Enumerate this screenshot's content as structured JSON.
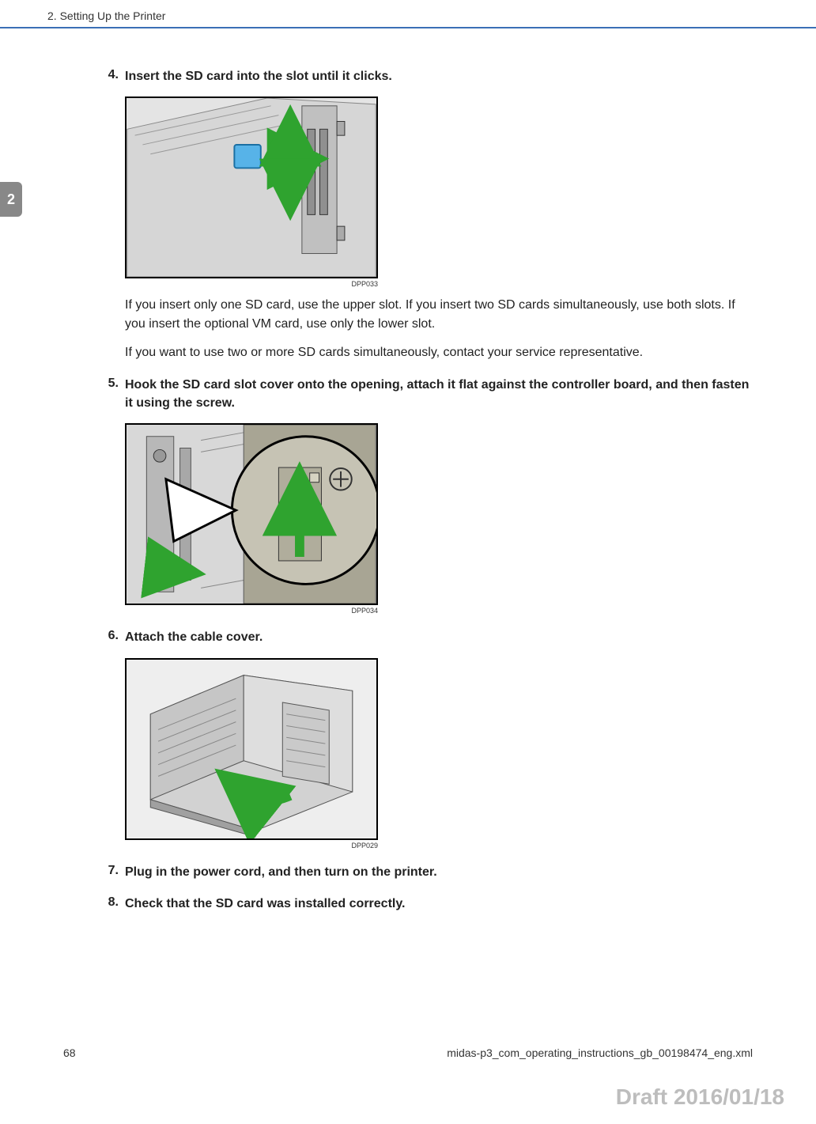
{
  "header": {
    "chapter_title": "2. Setting Up the Printer"
  },
  "chapter_tab": "2",
  "steps": [
    {
      "num": "4.",
      "title": "Insert the SD card into the slot until it clicks.",
      "figure_caption": "DPP033",
      "body": [
        "If you insert only one SD card, use the upper slot. If you insert two SD cards simultaneously, use both slots. If you insert the optional VM card, use only the lower slot.",
        "If you want to use two or more SD cards simultaneously, contact your service representative."
      ]
    },
    {
      "num": "5.",
      "title": "Hook the SD card slot cover onto the opening, attach it flat against the controller board, and then fasten it using the screw.",
      "figure_caption": "DPP034",
      "body": []
    },
    {
      "num": "6.",
      "title": "Attach the cable cover.",
      "figure_caption": "DPP029",
      "body": []
    },
    {
      "num": "7.",
      "title": "Plug in the power cord, and then turn on the printer.",
      "body": []
    },
    {
      "num": "8.",
      "title": "Check that the SD card was installed correctly.",
      "body": []
    }
  ],
  "footer": {
    "page_number": "68",
    "file_id": "midas-p3_com_operating_instructions_gb_00198474_eng.xml"
  },
  "draft_stamp": "Draft 2016/01/18"
}
